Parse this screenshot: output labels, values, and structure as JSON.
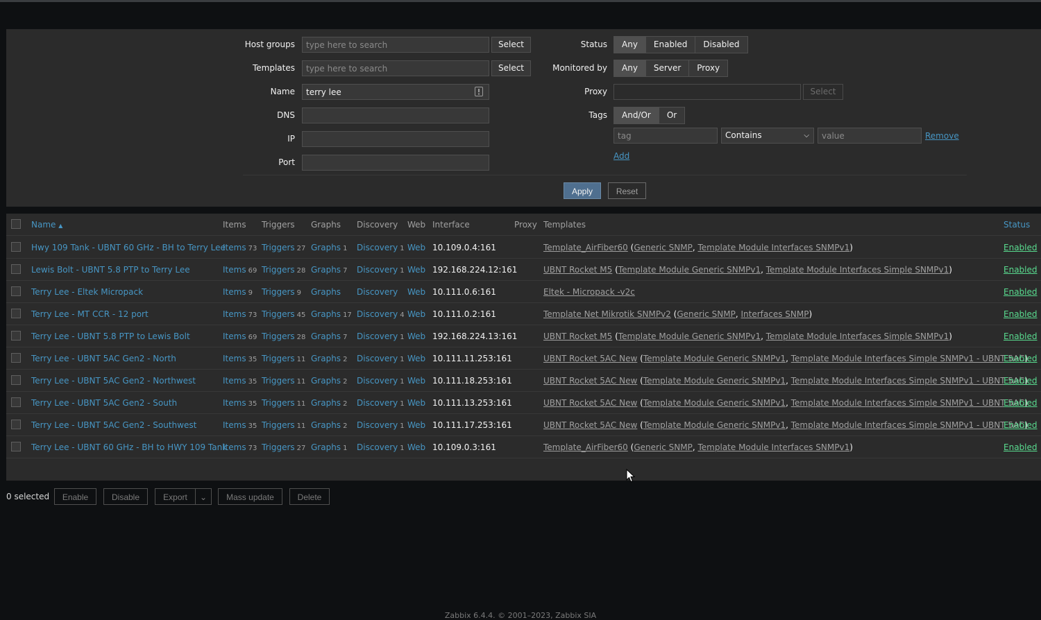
{
  "filter": {
    "host_groups": {
      "label": "Host groups",
      "placeholder": "type here to search",
      "button": "Select"
    },
    "templates": {
      "label": "Templates",
      "placeholder": "type here to search",
      "button": "Select"
    },
    "name": {
      "label": "Name",
      "value": "terry lee"
    },
    "dns": {
      "label": "DNS",
      "value": ""
    },
    "ip": {
      "label": "IP",
      "value": ""
    },
    "port": {
      "label": "Port",
      "value": ""
    },
    "status": {
      "label": "Status",
      "options": [
        "Any",
        "Enabled",
        "Disabled"
      ],
      "selected": "Any"
    },
    "monitored_by": {
      "label": "Monitored by",
      "options": [
        "Any",
        "Server",
        "Proxy"
      ],
      "selected": "Any"
    },
    "proxy": {
      "label": "Proxy",
      "value": "",
      "button": "Select"
    },
    "tags": {
      "label": "Tags",
      "options": [
        "And/Or",
        "Or"
      ],
      "selected": "And/Or",
      "tag_placeholder": "tag",
      "operator": "Contains",
      "value_placeholder": "value",
      "remove": "Remove",
      "add": "Add"
    },
    "apply": "Apply",
    "reset": "Reset"
  },
  "table": {
    "headers": {
      "name": "Name",
      "items": "Items",
      "triggers": "Triggers",
      "graphs": "Graphs",
      "discovery": "Discovery",
      "web": "Web",
      "interface": "Interface",
      "proxy": "Proxy",
      "templates": "Templates",
      "status": "Status"
    },
    "rows": [
      {
        "name": "Hwy 109 Tank - UBNT 60 GHz - BH to Terry Lee",
        "items": "Items",
        "items_n": "73",
        "triggers": "Triggers",
        "triggers_n": "27",
        "graphs": "Graphs",
        "graphs_n": "1",
        "discovery": "Discovery",
        "discovery_n": "1",
        "web": "Web",
        "interface": "10.109.0.4:161",
        "tpl_main": "Template_AirFiber60",
        "tpl_sub1": "Generic SNMP",
        "tpl_sub2": "Template Module Interfaces SNMPv1",
        "status": "Enabled"
      },
      {
        "name": "Lewis Bolt - UBNT 5.8 PTP to Terry Lee",
        "items": "Items",
        "items_n": "69",
        "triggers": "Triggers",
        "triggers_n": "28",
        "graphs": "Graphs",
        "graphs_n": "7",
        "discovery": "Discovery",
        "discovery_n": "1",
        "web": "Web",
        "interface": "192.168.224.12:161",
        "tpl_main": "UBNT Rocket M5",
        "tpl_sub1": "Template Module Generic SNMPv1",
        "tpl_sub2": "Template Module Interfaces Simple SNMPv1",
        "status": "Enabled"
      },
      {
        "name": "Terry Lee - Eltek Micropack",
        "items": "Items",
        "items_n": "9",
        "triggers": "Triggers",
        "triggers_n": "9",
        "graphs": "Graphs",
        "graphs_n": "",
        "discovery": "Discovery",
        "discovery_n": "",
        "web": "Web",
        "interface": "10.111.0.6:161",
        "tpl_main": "Eltek - Micropack -v2c",
        "tpl_sub1": "",
        "tpl_sub2": "",
        "status": "Enabled"
      },
      {
        "name": "Terry Lee - MT CCR - 12 port",
        "items": "Items",
        "items_n": "73",
        "triggers": "Triggers",
        "triggers_n": "45",
        "graphs": "Graphs",
        "graphs_n": "17",
        "discovery": "Discovery",
        "discovery_n": "4",
        "web": "Web",
        "interface": "10.111.0.2:161",
        "tpl_main": "Template Net Mikrotik SNMPv2",
        "tpl_sub1": "Generic SNMP",
        "tpl_sub2": "Interfaces SNMP",
        "status": "Enabled"
      },
      {
        "name": "Terry Lee - UBNT 5.8 PTP to Lewis Bolt",
        "items": "Items",
        "items_n": "69",
        "triggers": "Triggers",
        "triggers_n": "28",
        "graphs": "Graphs",
        "graphs_n": "7",
        "discovery": "Discovery",
        "discovery_n": "1",
        "web": "Web",
        "interface": "192.168.224.13:161",
        "tpl_main": "UBNT Rocket M5",
        "tpl_sub1": "Template Module Generic SNMPv1",
        "tpl_sub2": "Template Module Interfaces Simple SNMPv1",
        "status": "Enabled"
      },
      {
        "name": "Terry Lee - UBNT 5AC Gen2 - North",
        "items": "Items",
        "items_n": "35",
        "triggers": "Triggers",
        "triggers_n": "11",
        "graphs": "Graphs",
        "graphs_n": "2",
        "discovery": "Discovery",
        "discovery_n": "1",
        "web": "Web",
        "interface": "10.111.11.253:161",
        "tpl_main": "UBNT Rocket 5AC New",
        "tpl_sub1": "Template Module Generic SNMPv1",
        "tpl_sub2": "Template Module Interfaces Simple SNMPv1 - UBNT 5AC",
        "status": "Enabled"
      },
      {
        "name": "Terry Lee - UBNT 5AC Gen2 - Northwest",
        "items": "Items",
        "items_n": "35",
        "triggers": "Triggers",
        "triggers_n": "11",
        "graphs": "Graphs",
        "graphs_n": "2",
        "discovery": "Discovery",
        "discovery_n": "1",
        "web": "Web",
        "interface": "10.111.18.253:161",
        "tpl_main": "UBNT Rocket 5AC New",
        "tpl_sub1": "Template Module Generic SNMPv1",
        "tpl_sub2": "Template Module Interfaces Simple SNMPv1 - UBNT 5AC",
        "status": "Enabled"
      },
      {
        "name": "Terry Lee - UBNT 5AC Gen2 - South",
        "items": "Items",
        "items_n": "35",
        "triggers": "Triggers",
        "triggers_n": "11",
        "graphs": "Graphs",
        "graphs_n": "2",
        "discovery": "Discovery",
        "discovery_n": "1",
        "web": "Web",
        "interface": "10.111.13.253:161",
        "tpl_main": "UBNT Rocket 5AC New",
        "tpl_sub1": "Template Module Generic SNMPv1",
        "tpl_sub2": "Template Module Interfaces Simple SNMPv1 - UBNT 5AC",
        "status": "Enabled"
      },
      {
        "name": "Terry Lee - UBNT 5AC Gen2 - Southwest",
        "items": "Items",
        "items_n": "35",
        "triggers": "Triggers",
        "triggers_n": "11",
        "graphs": "Graphs",
        "graphs_n": "2",
        "discovery": "Discovery",
        "discovery_n": "1",
        "web": "Web",
        "interface": "10.111.17.253:161",
        "tpl_main": "UBNT Rocket 5AC New",
        "tpl_sub1": "Template Module Generic SNMPv1",
        "tpl_sub2": "Template Module Interfaces Simple SNMPv1 - UBNT 5AC",
        "status": "Enabled"
      },
      {
        "name": "Terry Lee - UBNT 60 GHz - BH to HWY 109 Tank",
        "items": "Items",
        "items_n": "73",
        "triggers": "Triggers",
        "triggers_n": "27",
        "graphs": "Graphs",
        "graphs_n": "1",
        "discovery": "Discovery",
        "discovery_n": "1",
        "web": "Web",
        "interface": "10.109.0.3:161",
        "tpl_main": "Template_AirFiber60",
        "tpl_sub1": "Generic SNMP",
        "tpl_sub2": "Template Module Interfaces SNMPv1",
        "status": "Enabled"
      }
    ]
  },
  "actions": {
    "selected": "0 selected",
    "enable": "Enable",
    "disable": "Disable",
    "export": "Export",
    "mass_update": "Mass update",
    "delete": "Delete"
  },
  "footer": "Zabbix 6.4.4. © 2001–2023, Zabbix SIA",
  "colors": {
    "link": "#4796c4",
    "enabled": "#59db8f",
    "panel": "#2b2b2b",
    "background": "#0e1012"
  },
  "icons": {
    "sort": "sort-asc-icon",
    "name_field": "contact-card-icon",
    "dropdown": "chevron-down-icon"
  }
}
